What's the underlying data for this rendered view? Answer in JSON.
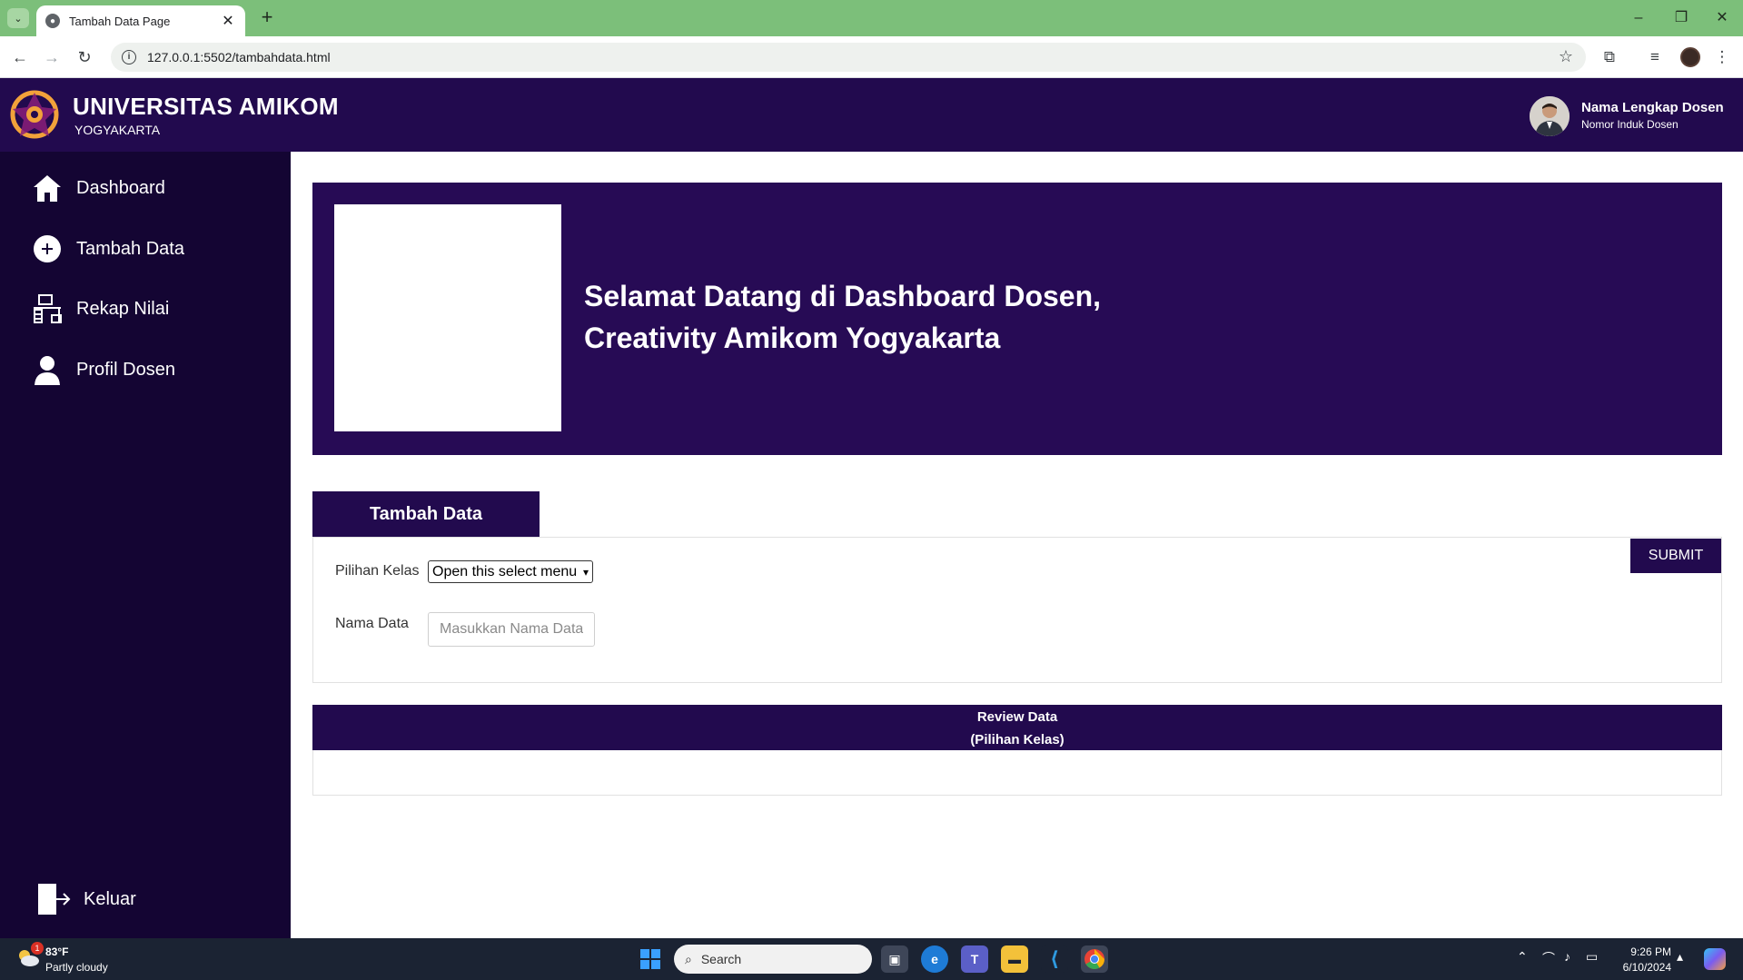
{
  "browser": {
    "tab_title": "Tambah Data Page",
    "url": "127.0.0.1:5502/tambahdata.html"
  },
  "header": {
    "brand_title": "UNIVERSITAS AMIKOM",
    "brand_subtitle": "YOGYAKARTA",
    "user_name": "Nama Lengkap Dosen",
    "user_id": "Nomor Induk Dosen"
  },
  "sidebar": {
    "items": [
      {
        "label": "Dashboard",
        "icon": "home-icon"
      },
      {
        "label": "Tambah Data",
        "icon": "plus-circle-icon"
      },
      {
        "label": "Rekap Nilai",
        "icon": "desk-icon"
      },
      {
        "label": "Profil Dosen",
        "icon": "user-icon"
      }
    ],
    "logout_label": "Keluar"
  },
  "banner": {
    "line1": "Selamat Datang di Dashboard Dosen,",
    "line2": "Creativity Amikom Yogyakarta"
  },
  "form": {
    "tab_label": "Tambah Data",
    "submit_label": "SUBMIT",
    "kelas_label": "Pilihan Kelas",
    "kelas_selected": "Open this select menu",
    "nama_label": "Nama Data",
    "nama_placeholder": "Masukkan Nama Data"
  },
  "review": {
    "title": "Review Data",
    "subtitle": "(Pilihan Kelas)"
  },
  "taskbar": {
    "temperature": "83°F",
    "weather": "Partly cloudy",
    "weather_badge": "1",
    "search_label": "Search",
    "time": "9:26 PM",
    "date": "6/10/2024"
  },
  "colors": {
    "header_bg": "#220a4e",
    "sidebar_bg": "#140533",
    "banner_bg": "#270b55",
    "chrome_green": "#7cbf7a"
  }
}
